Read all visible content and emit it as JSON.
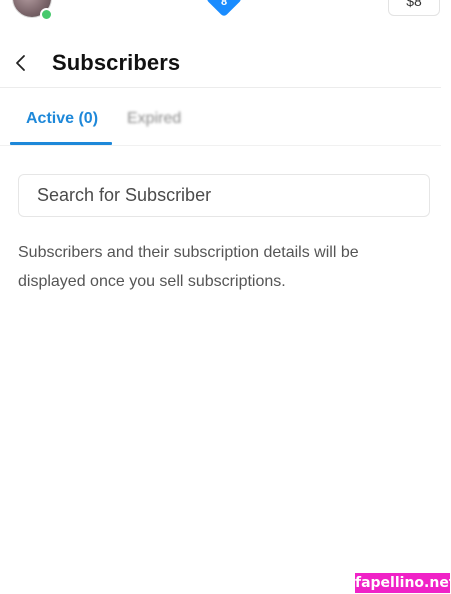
{
  "topbar": {
    "notification_count": "8",
    "balance": "$8"
  },
  "header": {
    "title": "Subscribers"
  },
  "tabs": [
    {
      "label": "Active (0)",
      "active": true
    },
    {
      "label": "Expired",
      "active": false
    },
    {
      "label": "",
      "active": false
    },
    {
      "label": "",
      "active": false
    }
  ],
  "search": {
    "placeholder": "Search for Subscriber",
    "value": ""
  },
  "empty_state": {
    "message": "Subscribers and their subscription details will be displayed once you sell subscriptions."
  },
  "watermark": {
    "text": "fapellino.net"
  },
  "colors": {
    "accent": "#1e88d9",
    "online": "#47c96d",
    "watermark_bg": "#f022c7"
  },
  "icons": {
    "back": "chevron-left-icon",
    "notifications": "home-badge-icon"
  }
}
